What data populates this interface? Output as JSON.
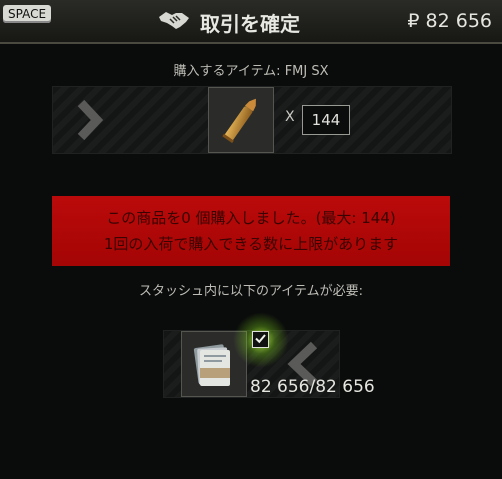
{
  "header": {
    "hotkey": "SPACE",
    "title": "取引を確定",
    "price": "₽ 82 656"
  },
  "purchase": {
    "caption": "購入するアイテム: FMJ SX",
    "multiplier": "X",
    "quantity": "144"
  },
  "alert": {
    "line1": "この商品を0 個購入しました。(最大: 144)",
    "line2": "1回の入荷で購入できる数に上限があります"
  },
  "requirement": {
    "caption": "スタッシュ内に以下のアイテムが必要:",
    "amount": "82 656/82 656"
  },
  "colors": {
    "alert_bg": "#b00808",
    "check_glow": "#a6ff3c"
  },
  "icons": [
    "handshake-icon",
    "chevron-right-icon",
    "bullet-cartridge-icon",
    "rouble-banknotes-icon",
    "checkmark-icon",
    "chevron-left-icon"
  ]
}
